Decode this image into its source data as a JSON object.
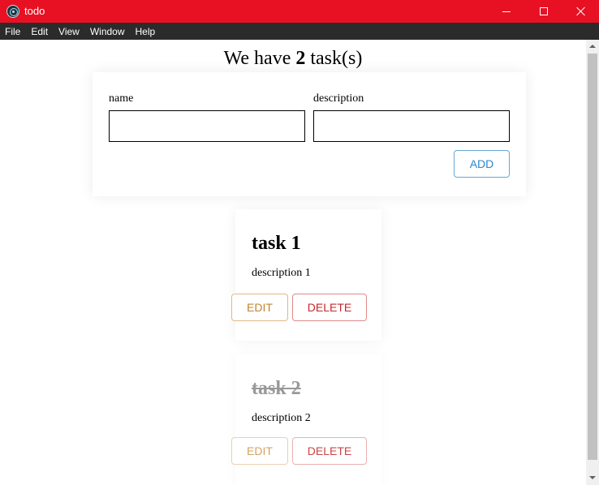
{
  "window": {
    "title": "todo",
    "icon": "electron-icon",
    "titlebar_color": "#e81123"
  },
  "menu": {
    "items": [
      "File",
      "Edit",
      "View",
      "Window",
      "Help"
    ]
  },
  "header": {
    "prefix": "We have ",
    "count": "2",
    "suffix": " task(s)"
  },
  "form": {
    "name_label": "name",
    "name_value": "",
    "description_label": "description",
    "description_value": "",
    "add_label": "ADD"
  },
  "tasks": [
    {
      "title": "task 1",
      "description": "description 1",
      "completed": false,
      "edit_label": "EDIT",
      "delete_label": "DELETE"
    },
    {
      "title": "task 2",
      "description": "description 2",
      "completed": true,
      "edit_label": "EDIT",
      "delete_label": "DELETE"
    }
  ],
  "colors": {
    "add_accent": "#2a88cc",
    "edit_accent": "#c0842e",
    "delete_accent": "#c6282a",
    "completed_title": "#999999"
  }
}
